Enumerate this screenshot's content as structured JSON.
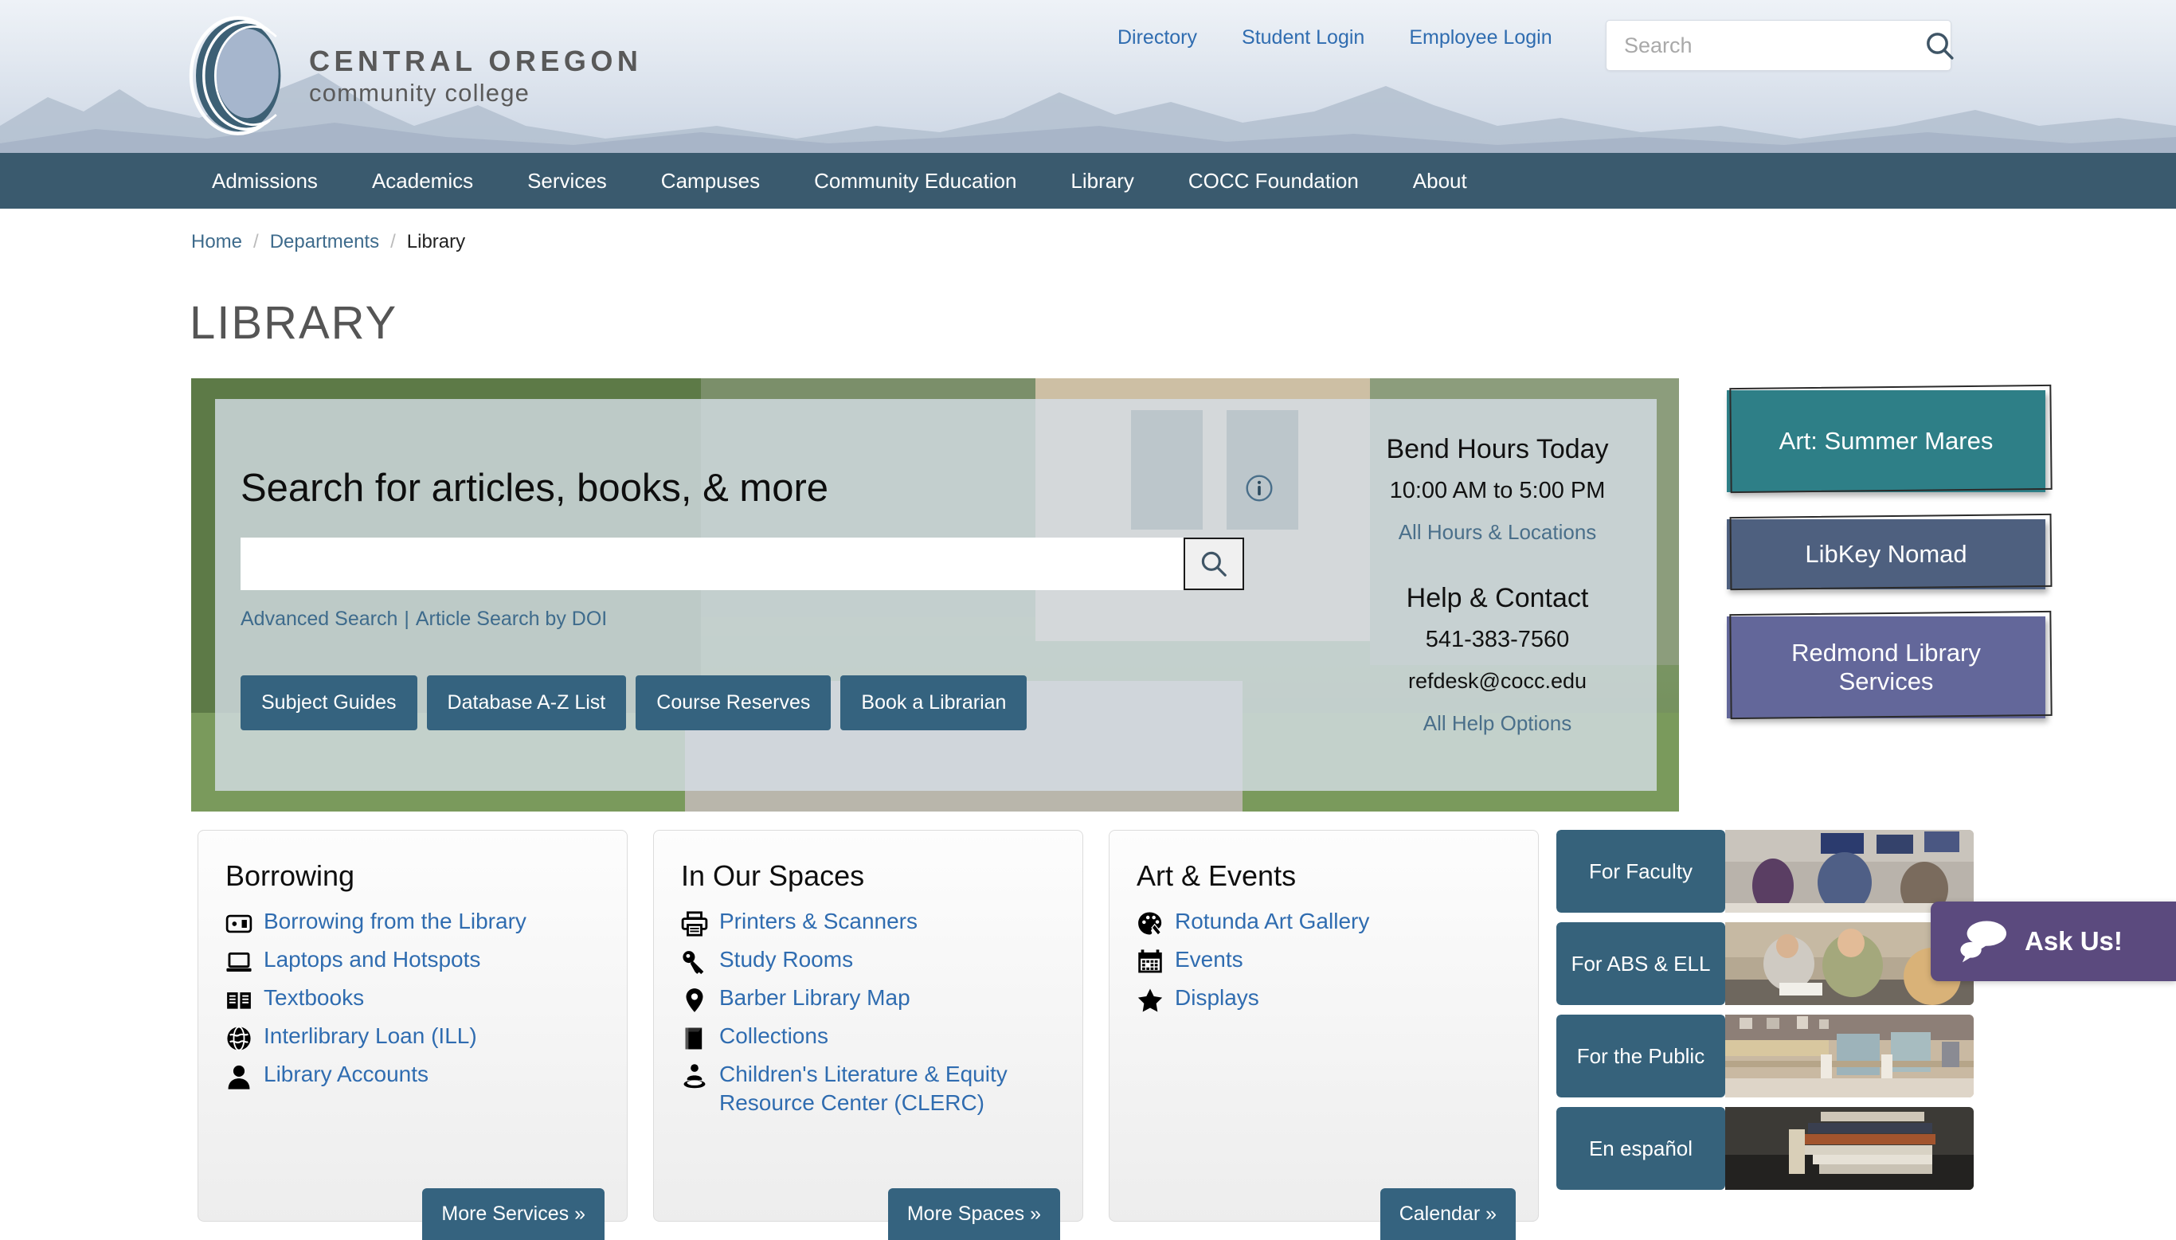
{
  "header": {
    "logo_line1": "CENTRAL OREGON",
    "logo_line2": "community college",
    "logo_icon": "cocc-circle-logo",
    "util_links": [
      {
        "label": "Directory"
      },
      {
        "label": "Student Login"
      },
      {
        "label": "Employee Login"
      }
    ],
    "search": {
      "placeholder": "Search",
      "value": "",
      "icon": "search-icon"
    }
  },
  "nav": {
    "items": [
      {
        "label": "Admissions"
      },
      {
        "label": "Academics"
      },
      {
        "label": "Services"
      },
      {
        "label": "Campuses"
      },
      {
        "label": "Community Education"
      },
      {
        "label": "Library"
      },
      {
        "label": "COCC Foundation"
      },
      {
        "label": "About"
      }
    ]
  },
  "breadcrumb": {
    "home": "Home",
    "departments": "Departments",
    "current": "Library",
    "separator": "/"
  },
  "page_title": "LIBRARY",
  "hero": {
    "heading": "Search for articles, books, & more",
    "search_value": "",
    "search_placeholder": "",
    "search_icon": "search-icon",
    "info_icon": "info-circle-icon",
    "advanced_search": "Advanced Search",
    "doi_search": "Article Search by DOI",
    "pipe": "|",
    "buttons": [
      {
        "label": "Subject Guides"
      },
      {
        "label": "Database A-Z List"
      },
      {
        "label": "Course Reserves"
      },
      {
        "label": "Book a Librarian"
      }
    ],
    "hours_title": "Bend Hours Today",
    "hours_time": "10:00 AM to 5:00 PM",
    "hours_link": "All Hours & Locations",
    "help_title": "Help & Contact",
    "help_phone": "541-383-7560",
    "help_email": "refdesk@cocc.edu",
    "help_link": "All Help Options"
  },
  "promos": [
    {
      "label": "Art: Summer Mares",
      "color": "#2e7f87"
    },
    {
      "label": "LibKey Nomad",
      "color": "#4e607f"
    },
    {
      "label": "Redmond Library Services",
      "color": "#63679a"
    }
  ],
  "cards": [
    {
      "title": "Borrowing",
      "more_label": "More Services »",
      "links": [
        {
          "label": "Borrowing from the Library",
          "icon": "id-card-icon"
        },
        {
          "label": "Laptops and Hotspots",
          "icon": "laptop-icon"
        },
        {
          "label": "Textbooks",
          "icon": "open-book-icon"
        },
        {
          "label": "Interlibrary Loan (ILL)",
          "icon": "globe-icon"
        },
        {
          "label": "Library Accounts",
          "icon": "user-icon"
        }
      ]
    },
    {
      "title": "In Our Spaces",
      "more_label": "More Spaces »",
      "links": [
        {
          "label": "Printers & Scanners",
          "icon": "printer-icon"
        },
        {
          "label": "Study Rooms",
          "icon": "key-icon"
        },
        {
          "label": "Barber Library Map",
          "icon": "map-pin-icon"
        },
        {
          "label": "Collections",
          "icon": "book-icon"
        },
        {
          "label": "Children's Literature & Equity Resource Center (CLERC)",
          "icon": "person-reading-icon"
        }
      ]
    },
    {
      "title": "Art & Events",
      "more_label": "Calendar »",
      "links": [
        {
          "label": "Rotunda Art Gallery",
          "icon": "palette-icon"
        },
        {
          "label": "Events",
          "icon": "calendar-icon"
        },
        {
          "label": "Displays",
          "icon": "star-icon"
        }
      ]
    }
  ],
  "tiles": [
    {
      "label": "For Faculty",
      "image": "classroom-photo"
    },
    {
      "label": "For ABS & ELL",
      "image": "tutoring-photo"
    },
    {
      "label": "For the Public",
      "image": "rotunda-photo"
    },
    {
      "label": "En español",
      "image": "spanish-books-photo"
    }
  ],
  "askus": {
    "label": "Ask Us!",
    "icon": "chat-bubbles-icon",
    "color": "#5b4a7e"
  },
  "colors": {
    "nav_bg": "#3a5a6e",
    "button_blue": "#35637f",
    "link_blue": "#2f6cb0",
    "breadcrumb_blue": "#3e6b8c"
  }
}
